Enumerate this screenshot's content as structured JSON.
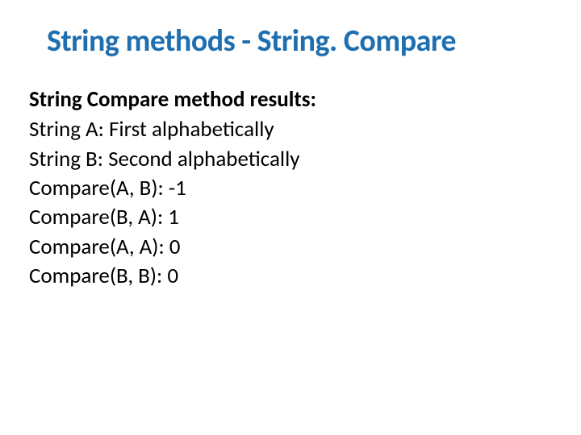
{
  "title": "String methods - String. Compare",
  "subtitle": "String Compare method results:",
  "lines": {
    "l0": "String A: First alphabetically",
    "l1": "String B: Second alphabetically",
    "l2": "Compare(A, B): -1",
    "l3": "Compare(B, A): 1",
    "l4": "Compare(A, A): 0",
    "l5": "Compare(B, B): 0"
  }
}
